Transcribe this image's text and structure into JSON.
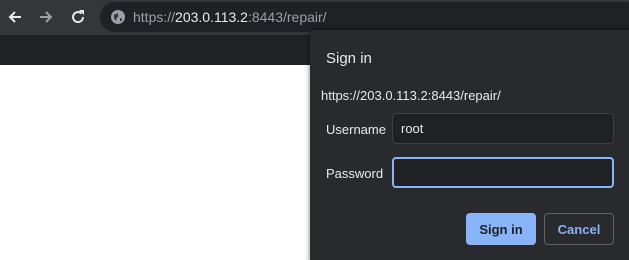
{
  "browser": {
    "url_scheme": "https://",
    "url_host": "203.0.113.2",
    "url_rest": ":8443/repair/",
    "icons": {
      "back": "arrow-left-icon",
      "forward": "arrow-right-icon",
      "reload": "reload-icon",
      "site_info": "globe-icon"
    }
  },
  "dialog": {
    "title": "Sign in",
    "origin": "https://203.0.113.2:8443/repair/",
    "username_label": "Username",
    "username_value": "root",
    "password_label": "Password",
    "password_value": "",
    "sign_in_label": "Sign in",
    "cancel_label": "Cancel"
  },
  "colors": {
    "toolbar_bg": "#35363a",
    "dialog_bg": "#292a2d",
    "accent": "#8ab4f8",
    "text": "#e8eaed"
  }
}
